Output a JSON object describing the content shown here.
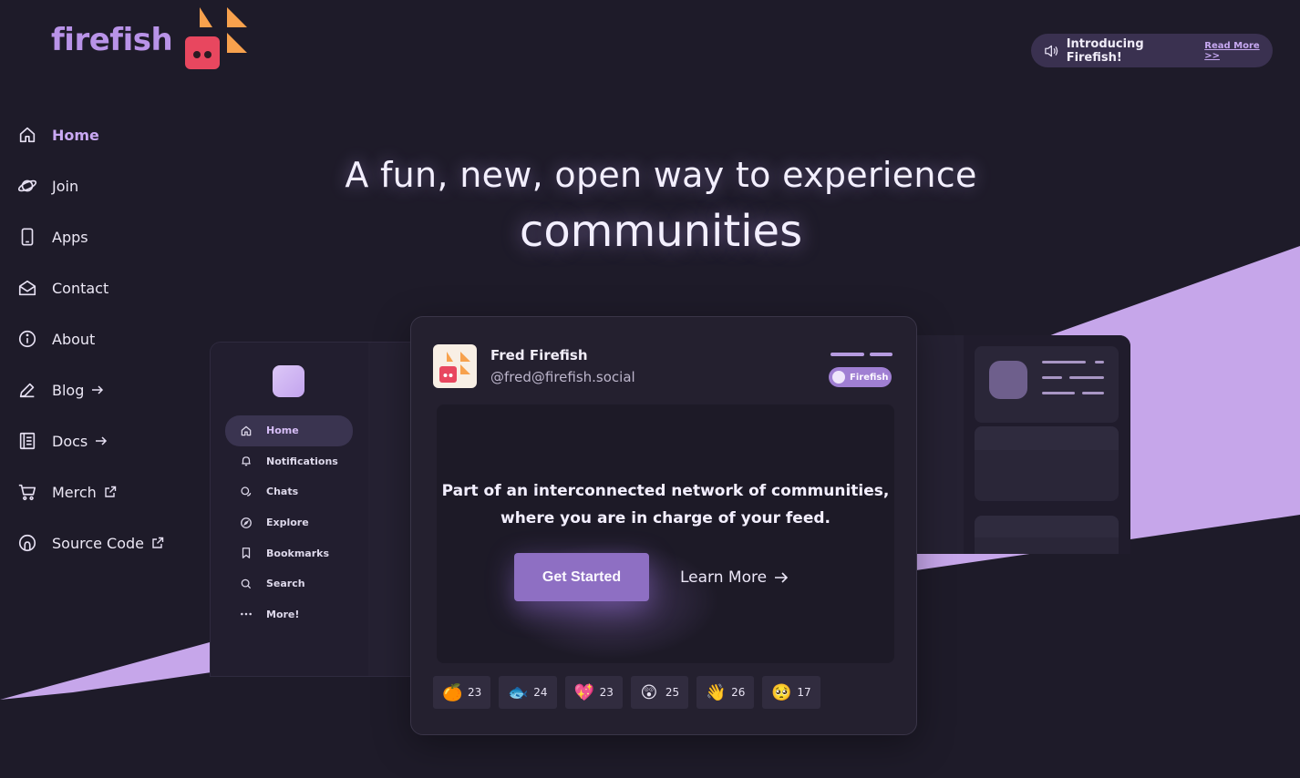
{
  "brand": {
    "name": "firefish"
  },
  "announcement": {
    "text": "Introducing Firefish!",
    "link": "Read More >>",
    "icon": "speaker-icon"
  },
  "nav": {
    "items": [
      {
        "label": "Home",
        "icon": "home-icon",
        "active": true
      },
      {
        "label": "Join",
        "icon": "planet-icon"
      },
      {
        "label": "Apps",
        "icon": "phone-icon"
      },
      {
        "label": "Contact",
        "icon": "mail-icon"
      },
      {
        "label": "About",
        "icon": "info-icon"
      },
      {
        "label": "Blog",
        "icon": "pencil-icon",
        "suffix": "arrow-right-icon"
      },
      {
        "label": "Docs",
        "icon": "book-icon",
        "suffix": "arrow-right-icon"
      },
      {
        "label": "Merch",
        "icon": "cart-icon",
        "suffix": "external-link-icon"
      },
      {
        "label": "Source Code",
        "icon": "git-icon",
        "suffix": "external-link-icon"
      }
    ]
  },
  "hero": {
    "line1": "A fun, new, open way to experience",
    "line2": "communities"
  },
  "mock_app": {
    "nav": [
      {
        "label": "Home",
        "icon": "home-icon",
        "active": true
      },
      {
        "label": "Notifications",
        "icon": "bell-icon"
      },
      {
        "label": "Chats",
        "icon": "chat-icon"
      },
      {
        "label": "Explore",
        "icon": "compass-icon"
      },
      {
        "label": "Bookmarks",
        "icon": "bookmark-icon"
      },
      {
        "label": "Search",
        "icon": "search-icon"
      },
      {
        "label": "More!",
        "icon": "more-icon"
      }
    ]
  },
  "post": {
    "name": "Fred Firefish",
    "handle": "@fred@firefish.social",
    "badge": "Firefish",
    "text_line1": "Part of an interconnected network of communities,",
    "text_line2": "where you are in charge of your feed.",
    "primary_button": "Get Started",
    "secondary_button": "Learn More",
    "reactions": [
      {
        "emoji": "🍊",
        "count": "23"
      },
      {
        "emoji": "🐟",
        "count": "24"
      },
      {
        "emoji": "💖",
        "count": "23"
      },
      {
        "emoji": "😲",
        "count": "25"
      },
      {
        "emoji": "👋",
        "count": "26"
      },
      {
        "emoji": "🥺",
        "count": "17"
      }
    ]
  },
  "colors": {
    "background": "#1e1b29",
    "accent": "#b993e8",
    "wave": "#c6a6ea",
    "button": "#8e6fc3"
  }
}
